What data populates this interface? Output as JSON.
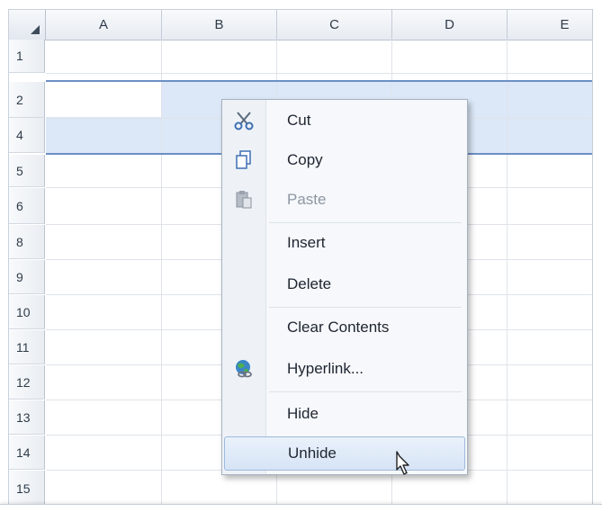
{
  "columns": [
    "A",
    "B",
    "C",
    "D",
    "E"
  ],
  "rows": [
    "1",
    "2",
    "4",
    "5",
    "6",
    "8",
    "9",
    "10",
    "11",
    "12",
    "13",
    "14",
    "15"
  ],
  "context_menu": {
    "items": [
      {
        "label": "Cut",
        "icon": "scissors-icon",
        "enabled": true
      },
      {
        "label": "Copy",
        "icon": "copy-icon",
        "enabled": true
      },
      {
        "label": "Paste",
        "icon": "paste-icon",
        "enabled": false
      },
      {
        "label": "Insert",
        "icon": "",
        "enabled": true
      },
      {
        "label": "Delete",
        "icon": "",
        "enabled": true
      },
      {
        "label": "Clear Contents",
        "icon": "",
        "enabled": true
      },
      {
        "label": "Hyperlink...",
        "icon": "hyperlink-globe-icon",
        "enabled": true
      },
      {
        "label": "Hide",
        "icon": "",
        "enabled": true
      },
      {
        "label": "Unhide",
        "icon": "",
        "enabled": true,
        "hovered": true
      }
    ]
  },
  "colors": {
    "selection": "#dce8f8",
    "hidden_row_marker": "#6b8fc4",
    "menu_hover": "#d6e4f6"
  }
}
